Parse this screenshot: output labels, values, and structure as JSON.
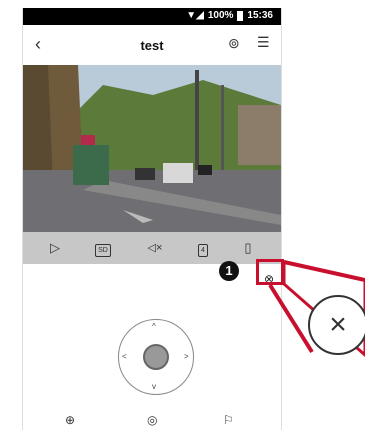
{
  "status": {
    "battery": "100%",
    "time": "15:36"
  },
  "header": {
    "title": "test",
    "back_icon": "chevron-left-icon",
    "settings_icon": "camera-settings-icon",
    "menu_icon": "menu-list-icon"
  },
  "controls": {
    "play": "▷",
    "quality": "SD",
    "mute": "◁×",
    "split": "4",
    "rotate": "▯"
  },
  "dpad": {
    "up": "^",
    "down": "v",
    "left": "<",
    "right": ">"
  },
  "panel": {
    "close": "⊗"
  },
  "bottom_bar": {
    "zoom": "⊕",
    "focus": "◎",
    "flag": "⚐"
  },
  "callout": {
    "number": "1",
    "close_zoom": "×",
    "accent": "#c8102e"
  }
}
